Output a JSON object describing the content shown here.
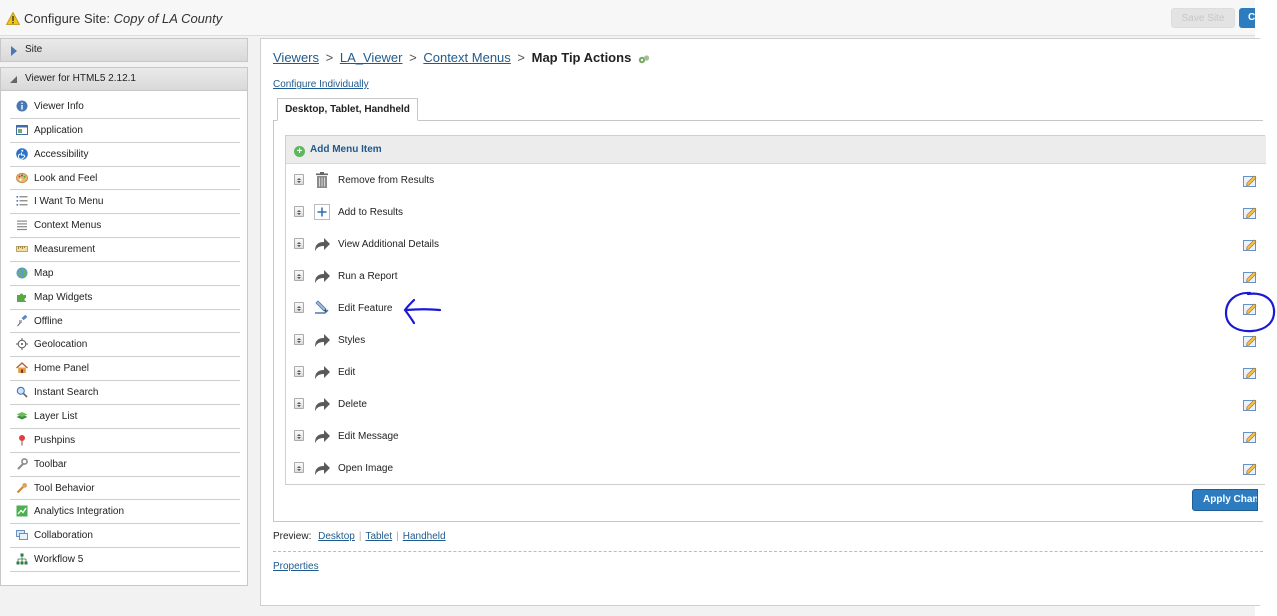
{
  "header": {
    "title_prefix": "Configure Site:",
    "site_name": "Copy of LA County",
    "save_label": "Save Site",
    "close_label": "Close"
  },
  "sidebar": {
    "site_label": "Site",
    "viewer_label": "Viewer for HTML5 2.12.1",
    "items": [
      {
        "label": "Viewer Info",
        "icon": "info-icon"
      },
      {
        "label": "Application",
        "icon": "application-icon"
      },
      {
        "label": "Accessibility",
        "icon": "accessibility-icon"
      },
      {
        "label": "Look and Feel",
        "icon": "palette-icon"
      },
      {
        "label": "I Want To Menu",
        "icon": "list-icon"
      },
      {
        "label": "Context Menus",
        "icon": "menu-lines-icon"
      },
      {
        "label": "Measurement",
        "icon": "ruler-icon"
      },
      {
        "label": "Map",
        "icon": "globe-icon"
      },
      {
        "label": "Map Widgets",
        "icon": "puzzle-icon"
      },
      {
        "label": "Offline",
        "icon": "satellite-icon"
      },
      {
        "label": "Geolocation",
        "icon": "crosshair-icon"
      },
      {
        "label": "Home Panel",
        "icon": "home-icon"
      },
      {
        "label": "Instant Search",
        "icon": "magnifier-icon"
      },
      {
        "label": "Layer List",
        "icon": "layers-icon"
      },
      {
        "label": "Pushpins",
        "icon": "pushpin-icon"
      },
      {
        "label": "Toolbar",
        "icon": "wrench-icon"
      },
      {
        "label": "Tool Behavior",
        "icon": "tool-icon"
      },
      {
        "label": "Analytics Integration",
        "icon": "analytics-icon"
      },
      {
        "label": "Collaboration",
        "icon": "collaboration-icon"
      },
      {
        "label": "Workflow 5",
        "icon": "workflow-icon"
      }
    ]
  },
  "breadcrumb": {
    "items": [
      "Viewers",
      "LA_Viewer",
      "Context Menus"
    ],
    "separator": ">",
    "current": "Map Tip Actions"
  },
  "configure_link": "Configure Individually",
  "tab_label": "Desktop, Tablet, Handheld",
  "add_item_label": "Add Menu Item",
  "menu_items": [
    {
      "label": "Remove from Results",
      "icon": "trash-icon"
    },
    {
      "label": "Add to Results",
      "icon": "plus-icon"
    },
    {
      "label": "View Additional Details",
      "icon": "arrow-icon"
    },
    {
      "label": "Run a Report",
      "icon": "arrow-icon"
    },
    {
      "label": "Edit Feature",
      "icon": "edit-feature-icon"
    },
    {
      "label": "Styles",
      "icon": "arrow-icon"
    },
    {
      "label": "Edit",
      "icon": "arrow-icon"
    },
    {
      "label": "Delete",
      "icon": "arrow-icon"
    },
    {
      "label": "Edit Message",
      "icon": "arrow-icon"
    },
    {
      "label": "Open Image",
      "icon": "arrow-icon"
    }
  ],
  "apply_label": "Apply Changes",
  "preview": {
    "label": "Preview:",
    "links": [
      "Desktop",
      "Tablet",
      "Handheld"
    ]
  },
  "properties_link": "Properties",
  "colors": {
    "link": "#1f5a8e",
    "primary_button": "#2c7cbf",
    "annotation": "#1a1ad6"
  }
}
